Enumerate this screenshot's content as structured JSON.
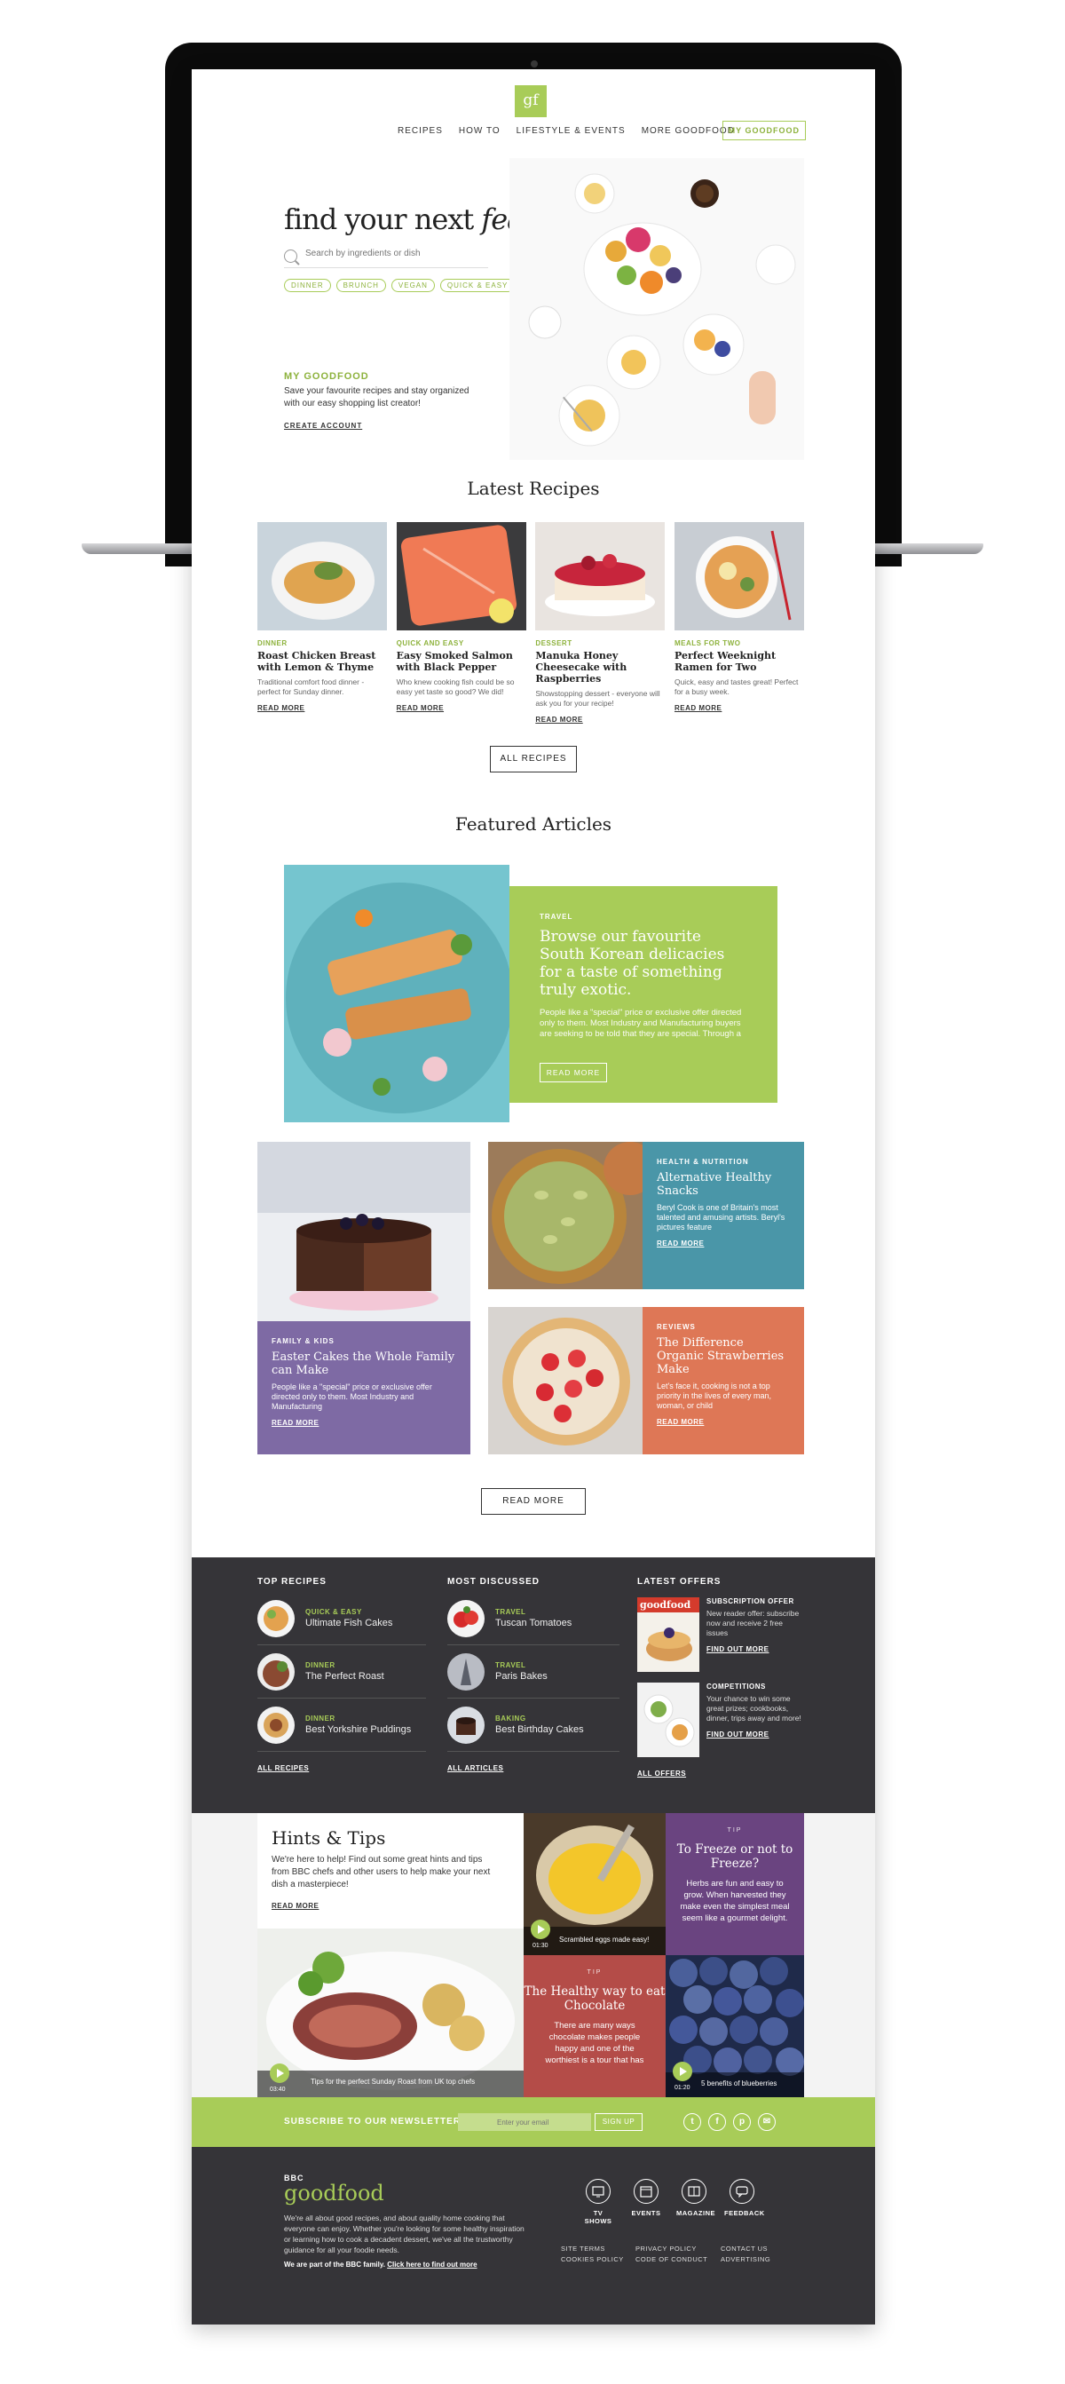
{
  "colors": {
    "brand_green": "#a8cc58",
    "dark": "#353438",
    "teal": "#4a96a8",
    "purple": "#7e6aa4",
    "orange": "#de7756",
    "plum": "#6a4480",
    "red": "#b44c48"
  },
  "header": {
    "logo": "gf",
    "nav": [
      "RECIPES",
      "HOW TO",
      "LIFESTYLE & EVENTS",
      "MORE GOODFOOD"
    ],
    "my_goodfood": "MY GOODFOOD"
  },
  "hero": {
    "title_plain": "find your next ",
    "title_em": "feast",
    "search_placeholder": "Search by ingredients or dish",
    "tags": [
      "DINNER",
      "BRUNCH",
      "VEGAN",
      "QUICK & EASY"
    ],
    "mygf_title": "MY GOODFOOD",
    "mygf_text": "Save your favourite recipes and stay organized with our easy shopping list creator!",
    "mygf_link": "CREATE ACCOUNT"
  },
  "latest": {
    "title": "Latest Recipes",
    "items": [
      {
        "cat": "DINNER",
        "name": "Roast Chicken Breast with Lemon & Thyme",
        "desc": "Traditional comfort food dinner - perfect for Sunday dinner.",
        "more": "READ MORE"
      },
      {
        "cat": "QUICK AND EASY",
        "name": "Easy Smoked Salmon with Black Pepper",
        "desc": "Who knew cooking fish could be so easy yet taste so good? We did!",
        "more": "READ MORE"
      },
      {
        "cat": "DESSERT",
        "name": "Manuka Honey Cheesecake with Raspberries",
        "desc": "Showstopping dessert - everyone will ask you for your recipe!",
        "more": "READ MORE"
      },
      {
        "cat": "MEALS FOR TWO",
        "name": "Perfect Weeknight Ramen for Two",
        "desc": "Quick, easy and tastes great! Perfect for a busy week.",
        "more": "READ MORE"
      }
    ],
    "all_button": "ALL RECIPES"
  },
  "featured": {
    "title": "Featured Articles",
    "main": {
      "cat": "TRAVEL",
      "head": "Browse our favourite South Korean delicacies for a taste of something truly exotic.",
      "body": "People like a \"special\" price or exclusive offer directed only to them. Most Industry and Manufacturing buyers are seeking to be told that they are special. Through a",
      "button": "READ MORE"
    },
    "grid": [
      {
        "cat": "FAMILY & KIDS",
        "head": "Easter Cakes the Whole Family can Make",
        "body": "People like a \"special\" price or exclusive offer directed only to them. Most Industry and Manufacturing",
        "more": "READ MORE"
      },
      {
        "cat": "HEALTH & NUTRITION",
        "head": "Alternative Healthy Snacks",
        "body": "Beryl Cook is one of Britain's most talented and amusing artists. Beryl's pictures feature",
        "more": "READ MORE"
      },
      {
        "cat": "REVIEWS",
        "head": "The Difference Organic Strawberries Make",
        "body": "Let's face it, cooking is not a top priority in the lives of every man, woman, or child",
        "more": "READ MORE"
      }
    ],
    "more_button": "READ MORE"
  },
  "dark": {
    "top_recipes": {
      "title": "TOP RECIPES",
      "items": [
        {
          "cat": "QUICK & EASY",
          "name": "Ultimate Fish Cakes"
        },
        {
          "cat": "DINNER",
          "name": "The Perfect Roast"
        },
        {
          "cat": "DINNER",
          "name": "Best Yorkshire Puddings"
        }
      ],
      "link": "ALL RECIPES"
    },
    "most_discussed": {
      "title": "MOST DISCUSSED",
      "items": [
        {
          "cat": "TRAVEL",
          "name": "Tuscan Tomatoes"
        },
        {
          "cat": "TRAVEL",
          "name": "Paris Bakes"
        },
        {
          "cat": "BAKING",
          "name": "Best Birthday Cakes"
        }
      ],
      "link": "ALL ARTICLES"
    },
    "latest_offers": {
      "title": "LATEST OFFERS",
      "magazine_label": "goodfood",
      "items": [
        {
          "title": "SUBSCRIPTION OFFER",
          "text": "New reader offer: subscribe now and receive 2 free issues",
          "link": "FIND OUT MORE"
        },
        {
          "title": "COMPETITIONS",
          "text": "Your chance to win some great prizes; cookbooks, dinner, trips away and more!",
          "link": "FIND OUT MORE"
        }
      ],
      "link": "ALL OFFERS"
    }
  },
  "hints": {
    "title": "Hints & Tips",
    "text": "We're here to help! Find out some great hints and tips from BBC chefs and other users to help make your next dish a masterpiece!",
    "link": "READ MORE",
    "video_main": {
      "time": "03:40",
      "caption": "Tips for the perfect Sunday Roast from UK top chefs"
    },
    "video_egg": {
      "time": "01:30",
      "caption": "Scrambled eggs made easy!"
    },
    "video_blue": {
      "time": "01:20",
      "caption": "5 benefits of blueberries"
    },
    "tip_freeze": {
      "label": "TIP",
      "head": "To Freeze or not to Freeze?",
      "body": "Herbs are fun and easy to grow. When harvested they make even the simplest meal seem like a gourmet delight."
    },
    "tip_choc": {
      "label": "TIP",
      "head": "The Healthy way to eat Chocolate",
      "body": "There are many ways chocolate makes people happy and one of the worthiest is a tour that has"
    }
  },
  "newsletter": {
    "label": "SUBSCRIBE TO OUR NEWSLETTER",
    "placeholder": "Enter your email",
    "button": "SIGN UP",
    "social": [
      "t",
      "f",
      "p",
      "✉"
    ]
  },
  "footer": {
    "bbc": "BBC",
    "logo": "goodfood",
    "text": "We're all about good recipes, and about quality home cooking that everyone can enjoy. Whether you're looking for some healthy inspiration or learning how to cook a decadent dessert, we've all the trustworthy guidance for all your foodie needs.",
    "bbc_line": "We are part of the BBC family.",
    "bbc_link": "Click here to find out more",
    "icons": [
      "TV SHOWS",
      "EVENTS",
      "MAGAZINE",
      "FEEDBACK"
    ],
    "links": [
      "SITE TERMS",
      "COOKIES POLICY",
      "PRIVACY POLICY",
      "CODE OF CONDUCT",
      "CONTACT US",
      "ADVERTISING"
    ]
  }
}
